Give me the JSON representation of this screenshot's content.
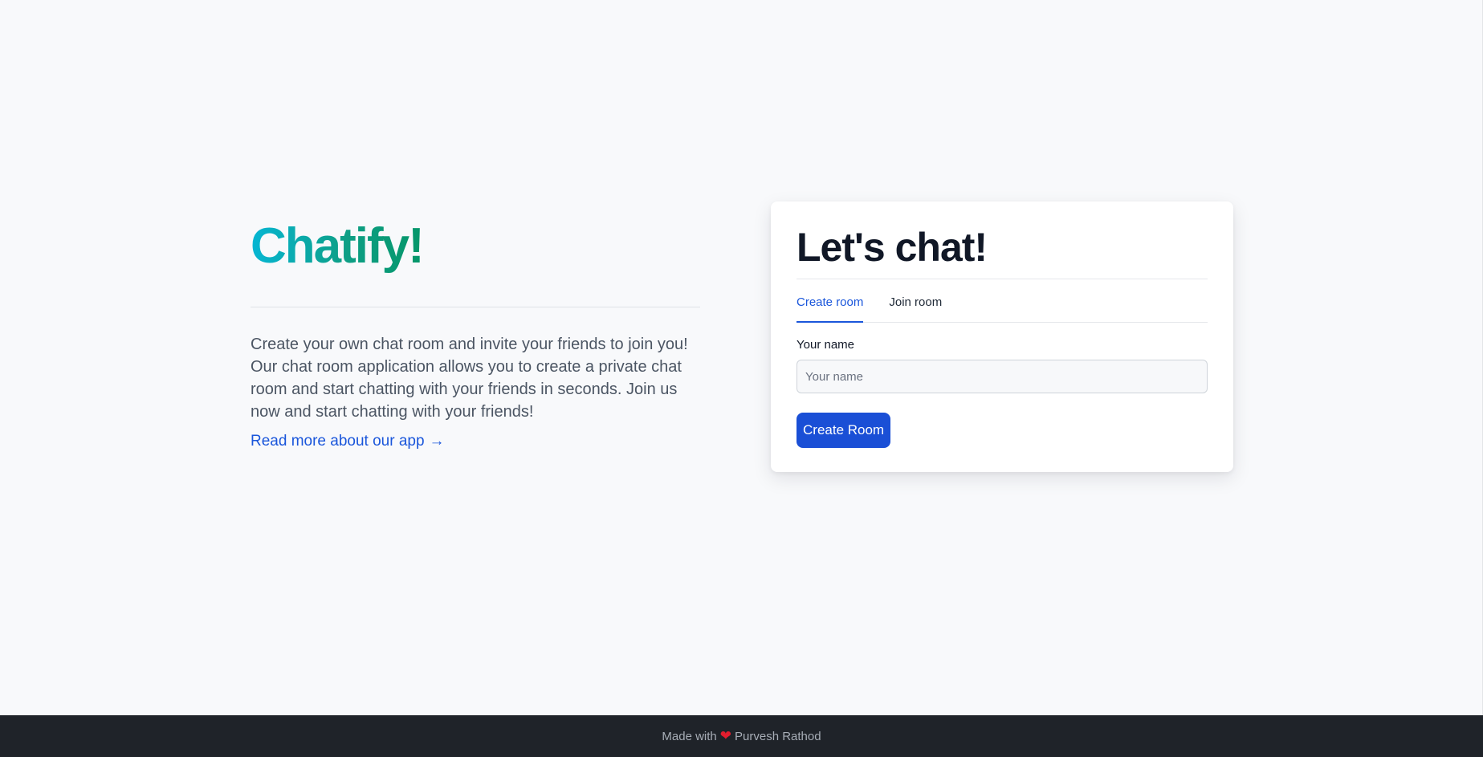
{
  "hero": {
    "brand_title": "Chatify!",
    "description": "Create your own chat room and invite your friends to join you! Our chat room application allows you to create a private chat room and start chatting with your friends in seconds. Join us now and start chatting with your friends!",
    "read_more_label": "Read more about our app",
    "read_more_arrow": "→",
    "brand_gradient": [
      "#06b6d4",
      "#059669"
    ]
  },
  "card": {
    "title": "Let's chat!",
    "tabs": [
      {
        "label": "Create room",
        "active": true
      },
      {
        "label": "Join room",
        "active": false
      }
    ],
    "name_label": "Your name",
    "name_placeholder": "Your name",
    "name_value": "",
    "submit_label": "Create Room"
  },
  "footer": {
    "prefix": "Made with",
    "heart_icon": "heart-icon",
    "heart": "❤",
    "author": "Purvesh Rathod"
  },
  "colors": {
    "accent": "#1a56db",
    "button": "#1a4fd6",
    "footer_bg": "#1f2329",
    "page_bg": "#f8f9fb"
  }
}
